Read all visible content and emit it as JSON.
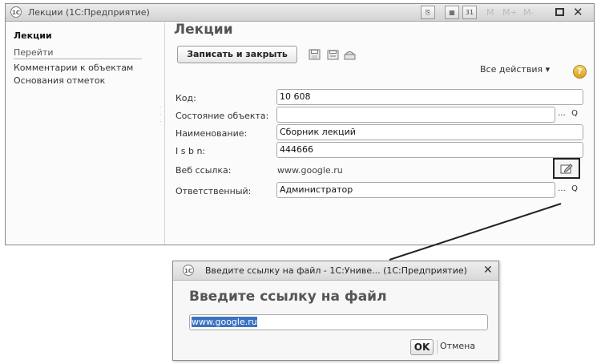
{
  "window": {
    "title": "Лекции  (1С:Предприятие)",
    "logo_text": "1С",
    "toolbar_m_labels": [
      "M",
      "M+",
      "M-"
    ]
  },
  "sidebar": {
    "title": "Лекции",
    "goto_label": "Перейти",
    "links": [
      "Комментарии к объектам",
      "Основания отметок"
    ]
  },
  "form": {
    "title": "Лекции",
    "save_close_label": "Записать и закрыть",
    "all_actions_label": "Все действия ▾",
    "help_label": "?",
    "fields": [
      {
        "label": "Код:",
        "value": "10 608"
      },
      {
        "label": "Состояние объекта:",
        "value": ""
      },
      {
        "label": "Наименование:",
        "value": "Сборник лекций"
      },
      {
        "label": "I s b n:",
        "value": "444666"
      },
      {
        "label": "Веб ссылка:",
        "value": "www.google.ru"
      },
      {
        "label": "Ответственный:",
        "value": "Администратор"
      }
    ],
    "pick_glyphs": [
      "...",
      "Q"
    ]
  },
  "dialog": {
    "title": "Введите ссылку на файл - 1С:Униве...  (1С:Предприятие)",
    "heading": "Введите ссылку на файл",
    "input_value": "www.google.ru",
    "ok_label": "OK",
    "cancel_label": "Отмена",
    "close_glyph": "✕"
  }
}
